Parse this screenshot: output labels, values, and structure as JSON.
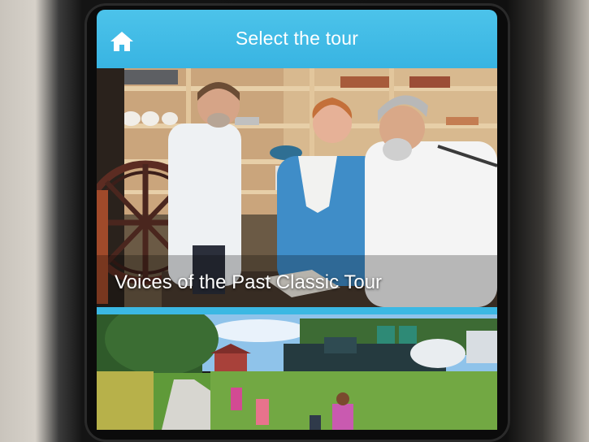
{
  "header": {
    "title": "Select the tour",
    "home_icon": "home-icon"
  },
  "tours": [
    {
      "label": "Voices of the Past Classic Tour"
    },
    {
      "label": ""
    }
  ],
  "colors": {
    "header_bg": "#3cb8e4",
    "header_text": "#ffffff"
  }
}
